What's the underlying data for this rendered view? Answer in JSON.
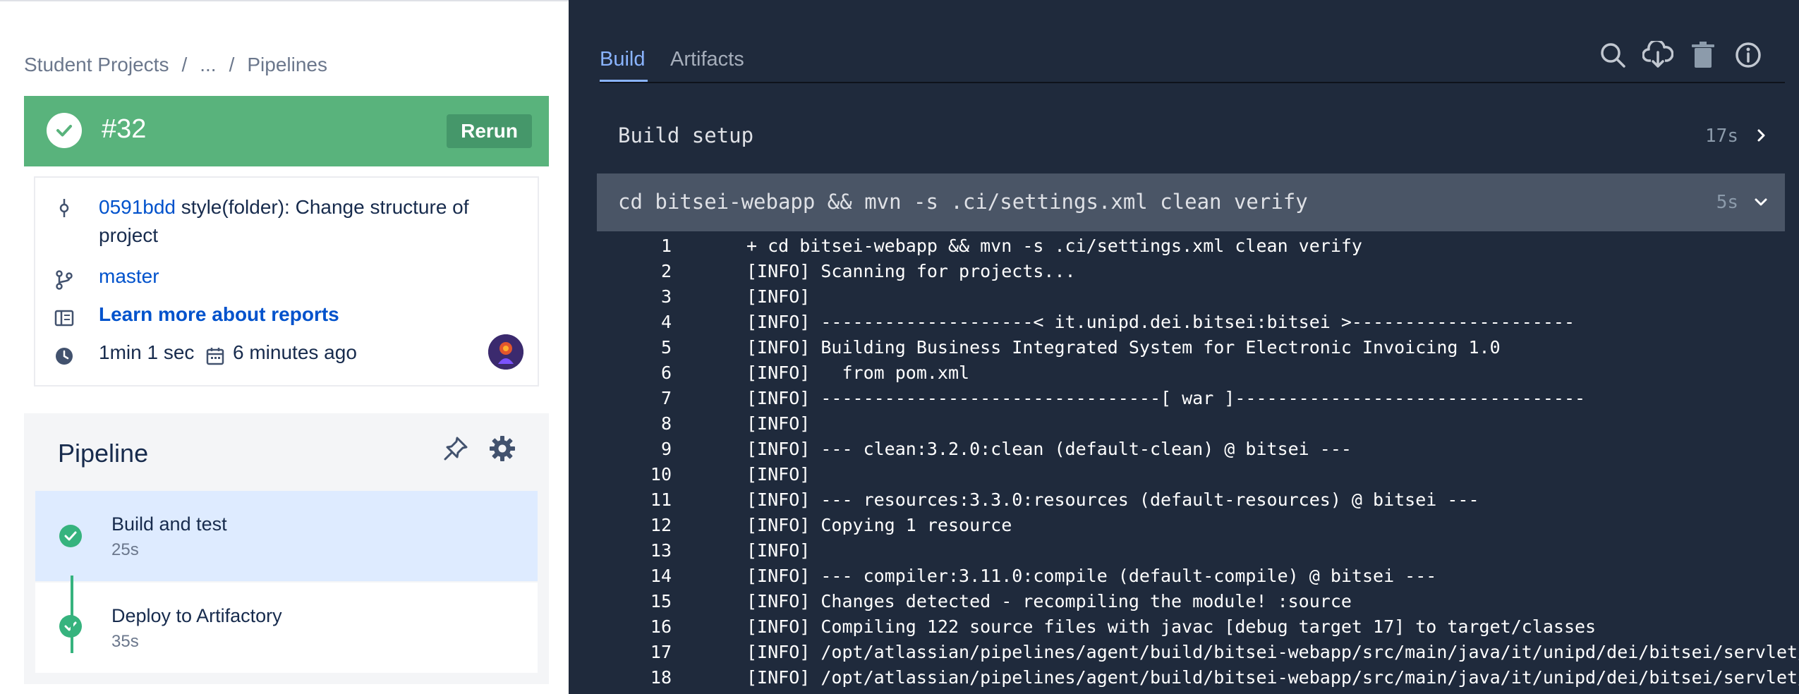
{
  "breadcrumb": {
    "items": [
      "Student Projects",
      "...",
      "Pipelines"
    ],
    "sep": "/"
  },
  "build": {
    "number": "#32",
    "rerun_label": "Rerun",
    "status_color": "#59b37c",
    "commit_hash": "0591bdd",
    "commit_message_line1": "style(folder): Change structure of",
    "commit_message_line2": "project",
    "branch": "master",
    "reports_link": "Learn more about reports",
    "duration": "1min 1 sec",
    "started": "6 minutes ago"
  },
  "pipeline": {
    "title": "Pipeline",
    "steps": [
      {
        "name": "Build and test",
        "duration": "25s"
      },
      {
        "name": "Deploy to Artifactory",
        "duration": "35s"
      }
    ]
  },
  "right": {
    "tabs": [
      "Build",
      "Artifacts"
    ],
    "active_tab": "Build",
    "toolbar_icons": [
      "search-icon",
      "download-icon",
      "trash-icon",
      "info-icon"
    ],
    "steps": [
      {
        "command": "Build setup",
        "duration": "17s"
      },
      {
        "command": "cd bitsei-webapp && mvn -s .ci/settings.xml clean verify",
        "duration": "5s"
      }
    ],
    "log_lines": [
      {
        "n": "1",
        "text": "+ cd bitsei-webapp && mvn -s .ci/settings.xml clean verify"
      },
      {
        "n": "2",
        "text": "[INFO] Scanning for projects..."
      },
      {
        "n": "3",
        "text": "[INFO]"
      },
      {
        "n": "4",
        "text": "[INFO] --------------------< it.unipd.dei.bitsei:bitsei >---------------------"
      },
      {
        "n": "5",
        "text": "[INFO] Building Business Integrated System for Electronic Invoicing 1.0"
      },
      {
        "n": "6",
        "text": "[INFO]   from pom.xml"
      },
      {
        "n": "7",
        "text": "[INFO] --------------------------------[ war ]---------------------------------"
      },
      {
        "n": "8",
        "text": "[INFO]"
      },
      {
        "n": "9",
        "text": "[INFO] --- clean:3.2.0:clean (default-clean) @ bitsei ---"
      },
      {
        "n": "10",
        "text": "[INFO]"
      },
      {
        "n": "11",
        "text": "[INFO] --- resources:3.3.0:resources (default-resources) @ bitsei ---"
      },
      {
        "n": "12",
        "text": "[INFO] Copying 1 resource"
      },
      {
        "n": "13",
        "text": "[INFO]"
      },
      {
        "n": "14",
        "text": "[INFO] --- compiler:3.11.0:compile (default-compile) @ bitsei ---"
      },
      {
        "n": "15",
        "text": "[INFO] Changes detected - recompiling the module! :source"
      },
      {
        "n": "16",
        "text": "[INFO] Compiling 122 source files with javac [debug target 17] to target/classes"
      },
      {
        "n": "17",
        "text": "[INFO] /opt/atlassian/pipelines/agent/build/bitsei-webapp/src/main/java/it/unipd/dei/bitsei/servlet/Filter"
      },
      {
        "n": "18",
        "text": "[INFO] /opt/atlassian/pipelines/agent/build/bitsei-webapp/src/main/java/it/unipd/dei/bitsei/servlet/Filter"
      }
    ]
  }
}
